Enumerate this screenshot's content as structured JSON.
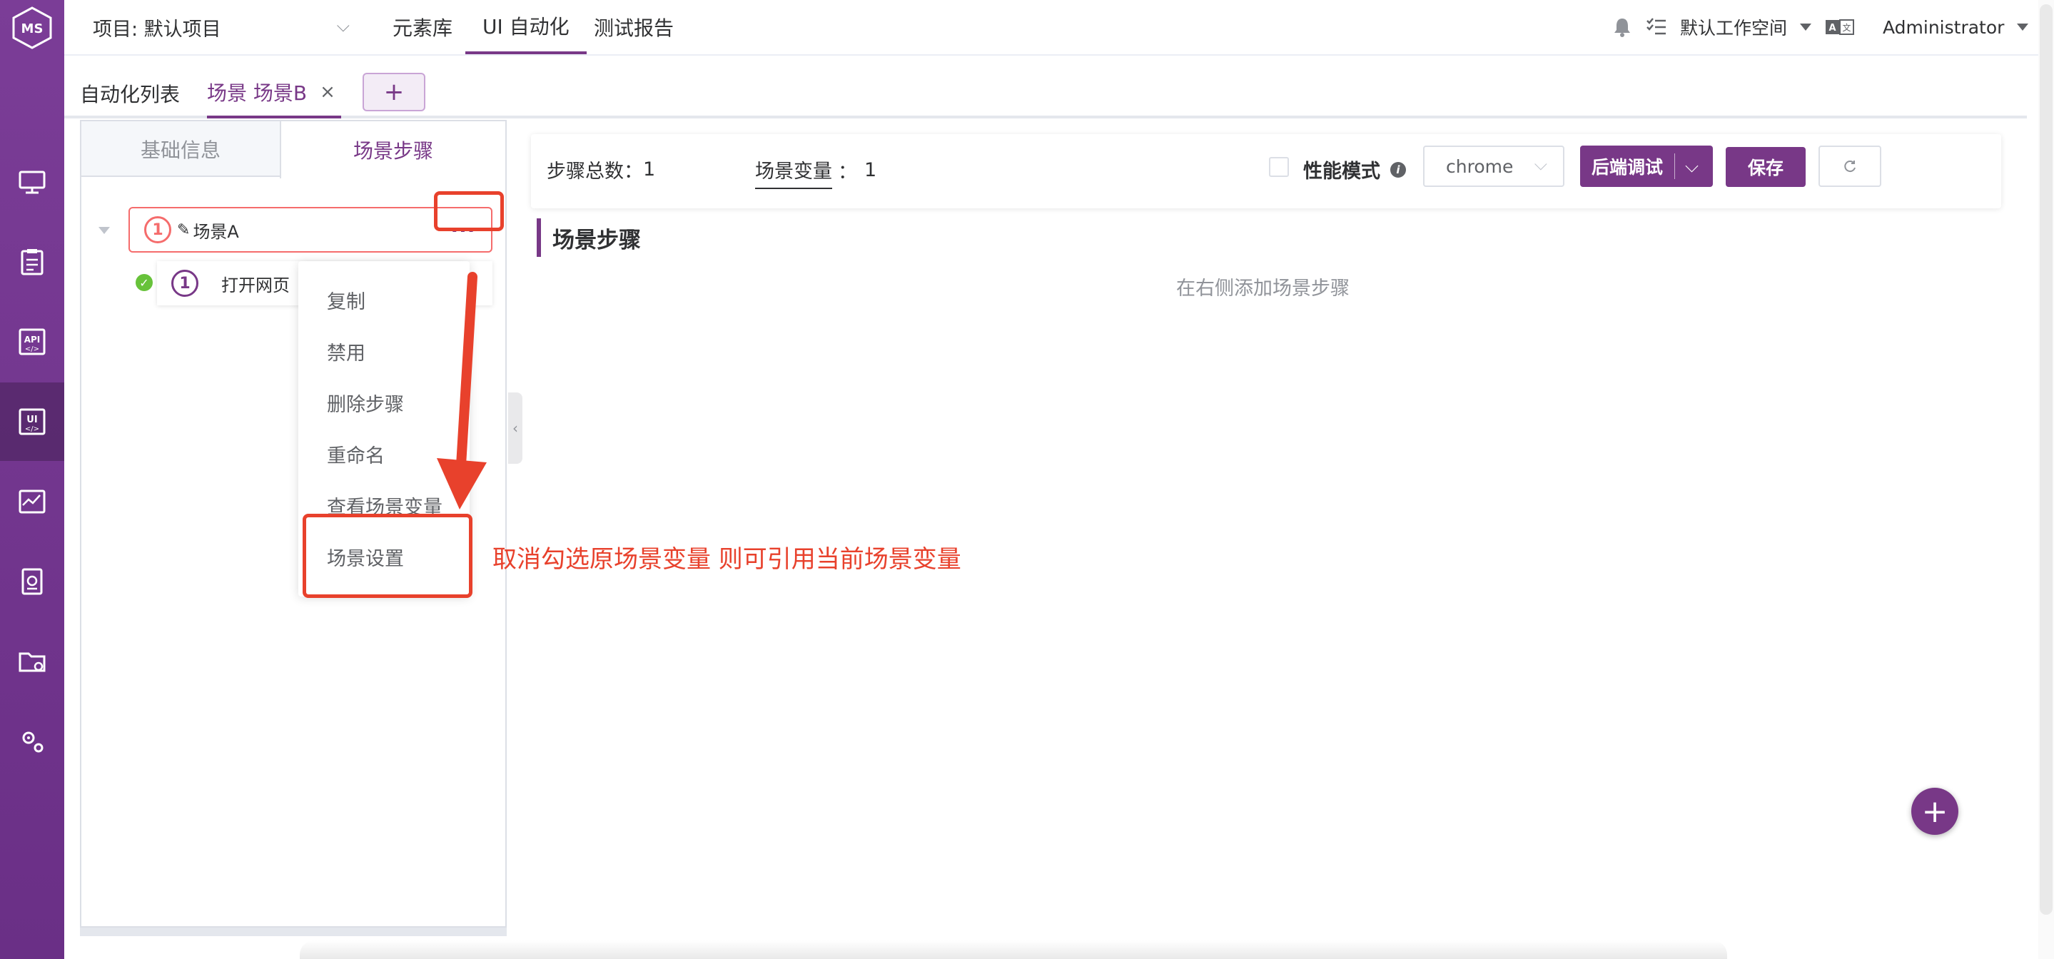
{
  "topbar": {
    "project": "项目: 默认项目",
    "nav": [
      "元素库",
      "UI 自动化",
      "测试报告"
    ],
    "workspace": "默认工作空间",
    "user": "Administrator"
  },
  "tabs": {
    "list_label": "自动化列表",
    "active_tab": "场景 场景B",
    "close": "×",
    "add": "+"
  },
  "left_panel": {
    "tab_basic": "基础信息",
    "tab_steps": "场景步骤",
    "scene_node": {
      "num": "1",
      "label": "场景A",
      "more": "···"
    },
    "step_node": {
      "num": "1",
      "label": "打开网页"
    }
  },
  "dropdown": [
    "复制",
    "禁用",
    "删除步骤",
    "重命名",
    "查看场景变量",
    "场景设置"
  ],
  "annotation": "取消勾选原场景变量 则可引用当前场景变量",
  "right_header": {
    "total_steps_label": "步骤总数",
    "total_steps_value": "1",
    "scene_vars_label": "场景变量",
    "scene_vars_value": "1",
    "perf_mode": "性能模式",
    "browser": "chrome",
    "debug": "后端调试",
    "save": "保存"
  },
  "main": {
    "section_title": "场景步骤",
    "empty_hint": "在右侧添加场景步骤"
  },
  "colors": {
    "brand": "#783887",
    "annotation": "#e8412c",
    "error": "#f56c6c",
    "success": "#67c23a"
  }
}
